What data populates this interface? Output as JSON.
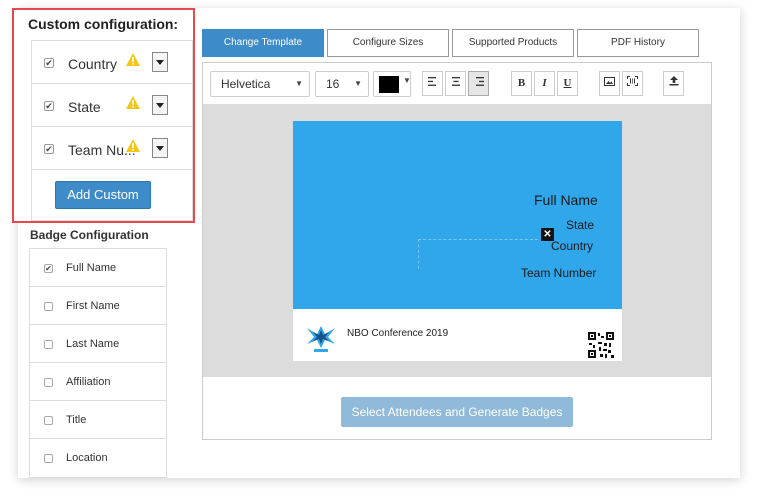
{
  "custom_config": {
    "title": "Custom configuration:",
    "items": [
      {
        "label": "Country",
        "checked": true
      },
      {
        "label": "State",
        "checked": true
      },
      {
        "label": "Team Nu...",
        "checked": true
      }
    ],
    "add_button": "Add Custom"
  },
  "badge_config": {
    "title": "Badge Configuration",
    "items": [
      {
        "label": "Full Name",
        "checked": true
      },
      {
        "label": "First Name",
        "checked": false
      },
      {
        "label": "Last Name",
        "checked": false
      },
      {
        "label": "Affiliation",
        "checked": false
      },
      {
        "label": "Title",
        "checked": false
      },
      {
        "label": "Location",
        "checked": false
      }
    ]
  },
  "tabs": [
    "Change Template",
    "Configure Sizes",
    "Supported Products",
    "PDF History"
  ],
  "toolbar": {
    "font": "Helvetica",
    "size": "16",
    "color": "#000000",
    "buttons": {
      "align_left": "≡",
      "align_center": "≡",
      "align_right": "≡",
      "bold": "B",
      "italic": "I",
      "underline": "U"
    }
  },
  "badge": {
    "full_name": "Full Name",
    "state": "State",
    "country": "Country",
    "team_number": "Team Number",
    "footer": "NBO Conference 2019",
    "background": "#2fa7ea"
  },
  "generate_button": "Select Attendees and Generate Badges",
  "colors": {
    "accent": "#3d8bc9",
    "highlight": "#e8474c",
    "warning": "#f5c518"
  }
}
